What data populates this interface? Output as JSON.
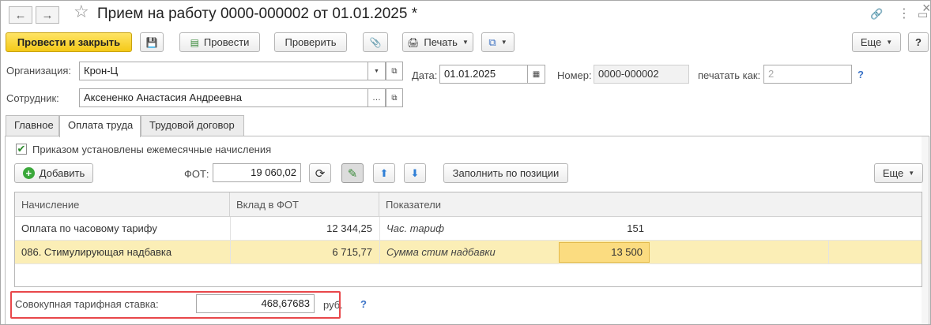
{
  "window": {
    "title": "Прием на работу 0000-000002 от 01.01.2025 *",
    "back_icon": "←",
    "forward_icon": "→",
    "star_icon": "☆",
    "link_icon": "🔗",
    "more_icon": "⋮",
    "restore_icon": "▭",
    "close_icon": "×"
  },
  "toolbar": {
    "post_close": "Провести и закрыть",
    "save_icon": "💾",
    "post": "Провести",
    "check": "Проверить",
    "attach_icon": "📎",
    "print": "Печать",
    "print_icon": "🖨",
    "more_docs_icon": "⧉",
    "more": "Еще",
    "help": "?"
  },
  "header": {
    "org_label": "Организация:",
    "org_value": "Крон-Ц",
    "date_label": "Дата:",
    "date_value": "01.01.2025",
    "number_label": "Номер:",
    "number_value": "0000-000002",
    "print_as_label": "печатать как:",
    "print_as_value": "2",
    "employee_label": "Сотрудник:",
    "employee_value": "Аксененко Анастасия Андреевна",
    "help": "?"
  },
  "tabs": [
    {
      "label": "Главное"
    },
    {
      "label": "Оплата труда"
    },
    {
      "label": "Трудовой договор"
    }
  ],
  "pay": {
    "checkbox_label": "Приказом установлены ежемесячные начисления",
    "checkbox_mark": "✔",
    "add": "Добавить",
    "fot_label": "ФОТ:",
    "fot_value": "19 060,02",
    "refresh_icon": "⟳",
    "edit_icon": "✎",
    "up_icon": "⬆",
    "down_icon": "⬇",
    "fill": "Заполнить по позиции",
    "more": "Еще"
  },
  "table": {
    "columns": [
      "Начисление",
      "Вклад в ФОТ",
      "Показатели"
    ],
    "rows": [
      {
        "name": "Оплата по часовому тарифу",
        "contrib": "12 344,25",
        "indicator": "Час. тариф",
        "value": "151"
      },
      {
        "name": "086. Стимулирующая надбавка",
        "contrib": "6 715,77",
        "indicator": "Сумма стим надбавки",
        "value": "13 500"
      }
    ]
  },
  "footer": {
    "rate_label": "Совокупная тарифная ставка:",
    "rate_value": "468,67683",
    "rate_unit": "руб.",
    "help": "?"
  }
}
